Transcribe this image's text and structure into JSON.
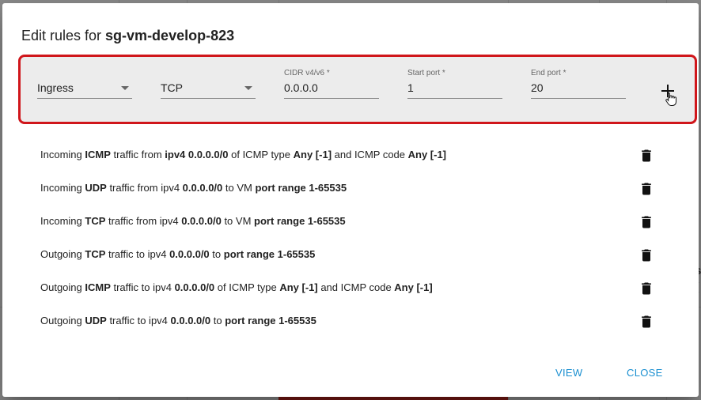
{
  "dialog": {
    "title_prefix": "Edit rules for ",
    "title_name": "sg-vm-develop-823"
  },
  "form": {
    "direction": {
      "value": "Ingress",
      "label": ""
    },
    "protocol": {
      "value": "TCP",
      "label": ""
    },
    "cidr": {
      "label": "CIDR v4/v6 *",
      "value": "0.0.0.0"
    },
    "start_port": {
      "label": "Start port *",
      "value": "1"
    },
    "end_port": {
      "label": "End port *",
      "value": "20"
    },
    "add_icon": "plus-icon"
  },
  "rules": [
    {
      "segments": [
        {
          "t": "Incoming ",
          "b": false
        },
        {
          "t": "ICMP",
          "b": true
        },
        {
          "t": " traffic from ",
          "b": false
        },
        {
          "t": "ipv4 0.0.0.0/0",
          "b": true
        },
        {
          "t": " of ICMP type ",
          "b": false
        },
        {
          "t": "Any [-1]",
          "b": true
        },
        {
          "t": " and ICMP code ",
          "b": false
        },
        {
          "t": "Any [-1]",
          "b": true
        }
      ]
    },
    {
      "segments": [
        {
          "t": "Incoming ",
          "b": false
        },
        {
          "t": "UDP",
          "b": true
        },
        {
          "t": " traffic from ipv4 ",
          "b": false
        },
        {
          "t": "0.0.0.0/0",
          "b": true
        },
        {
          "t": " to VM ",
          "b": false
        },
        {
          "t": "port range 1-65535",
          "b": true
        }
      ]
    },
    {
      "segments": [
        {
          "t": "Incoming ",
          "b": false
        },
        {
          "t": "TCP",
          "b": true
        },
        {
          "t": " traffic from ipv4 ",
          "b": false
        },
        {
          "t": "0.0.0.0/0",
          "b": true
        },
        {
          "t": " to VM ",
          "b": false
        },
        {
          "t": "port range 1-65535",
          "b": true
        }
      ]
    },
    {
      "segments": [
        {
          "t": "Outgoing ",
          "b": false
        },
        {
          "t": "TCP",
          "b": true
        },
        {
          "t": " traffic to ipv4 ",
          "b": false
        },
        {
          "t": "0.0.0.0/0",
          "b": true
        },
        {
          "t": " to ",
          "b": false
        },
        {
          "t": "port range 1-65535",
          "b": true
        }
      ]
    },
    {
      "segments": [
        {
          "t": "Outgoing ",
          "b": false
        },
        {
          "t": "ICMP",
          "b": true
        },
        {
          "t": " traffic to ipv4 ",
          "b": false
        },
        {
          "t": "0.0.0.0/0",
          "b": true
        },
        {
          "t": " of ICMP type ",
          "b": false
        },
        {
          "t": "Any [-1]",
          "b": true
        },
        {
          "t": " and ICMP code ",
          "b": false
        },
        {
          "t": "Any [-1]",
          "b": true
        }
      ]
    },
    {
      "segments": [
        {
          "t": "Outgoing ",
          "b": false
        },
        {
          "t": "UDP",
          "b": true
        },
        {
          "t": " traffic to ipv4 ",
          "b": false
        },
        {
          "t": "0.0.0.0/0",
          "b": true
        },
        {
          "t": " to ",
          "b": false
        },
        {
          "t": "port range 1-65535",
          "b": true
        }
      ]
    }
  ],
  "rule_delete_icon": "trash-icon",
  "footer": {
    "view_label": "VIEW",
    "close_label": "CLOSE"
  },
  "background_peek": {
    "text1": "s",
    "text2": "("
  },
  "colors": {
    "highlight_border": "#d0161b",
    "link": "#1a8fd0"
  }
}
